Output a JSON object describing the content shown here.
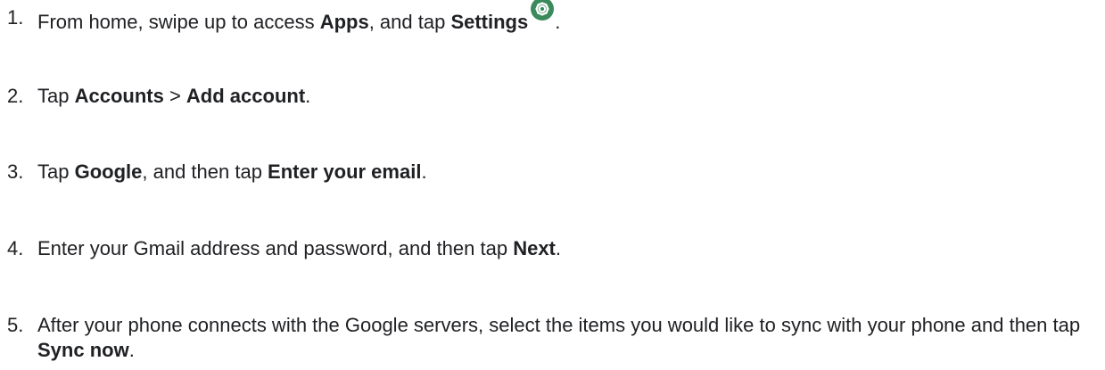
{
  "steps": [
    {
      "number": "1.",
      "parts": [
        "From home, swipe up to access ",
        "Apps",
        ", and tap ",
        "Settings",
        "."
      ],
      "icon": "settings-gear-icon",
      "icon_color": "#2e8b57"
    },
    {
      "number": "2.",
      "parts": [
        "Tap ",
        "Accounts",
        " > ",
        "Add account",
        "."
      ]
    },
    {
      "number": "3.",
      "parts": [
        "Tap ",
        "Google",
        ", and then tap ",
        "Enter your email",
        "."
      ]
    },
    {
      "number": "4.",
      "parts": [
        "Enter your Gmail address and password, and then tap ",
        "Next",
        "."
      ]
    },
    {
      "number": "5.",
      "parts": [
        "After your phone connects with the Google servers, select the items you would like to sync with your phone and then tap ",
        "Sync now",
        "."
      ]
    }
  ]
}
